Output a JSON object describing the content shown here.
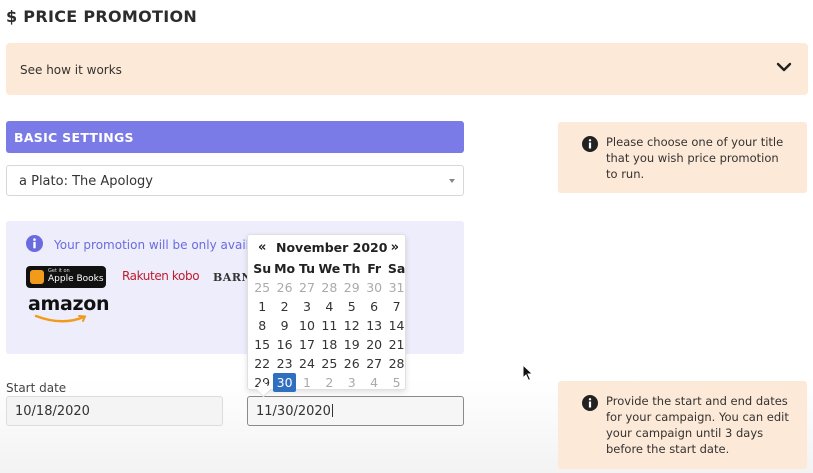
{
  "page": {
    "title": "$ PRICE PROMOTION"
  },
  "how_it_works": {
    "label": "See how it works",
    "icon": "chevron-down-icon"
  },
  "basic_settings": {
    "header": "BASIC SETTINGS",
    "title_select": {
      "value": "a Plato: The Apology"
    }
  },
  "info_title": {
    "text": "Please choose one of your title that you wish price promotion to run."
  },
  "availability": {
    "text": "Your promotion will be only availab",
    "stores": {
      "apple_small": "Get it on",
      "apple_big": "Apple Books",
      "kobo": "Rakuten kobo",
      "barnes": "BARNES",
      "amazon": "amazon"
    }
  },
  "dates": {
    "start_label": "Start date",
    "start_value": "10/18/2020",
    "end_value": "11/30/2020"
  },
  "info_dates": {
    "text": "Provide the start and end dates for your campaign. You can edit your campaign until 3 days before the start date."
  },
  "datepicker": {
    "prev": "«",
    "next": "»",
    "title": "November 2020",
    "days_of_week": [
      "Su",
      "Mo",
      "Tu",
      "We",
      "Th",
      "Fr",
      "Sa"
    ],
    "weeks": [
      [
        {
          "d": "25",
          "o": true
        },
        {
          "d": "26",
          "o": true
        },
        {
          "d": "27",
          "o": true
        },
        {
          "d": "28",
          "o": true
        },
        {
          "d": "29",
          "o": true
        },
        {
          "d": "30",
          "o": true
        },
        {
          "d": "31",
          "o": true
        }
      ],
      [
        {
          "d": "1"
        },
        {
          "d": "2"
        },
        {
          "d": "3"
        },
        {
          "d": "4"
        },
        {
          "d": "5"
        },
        {
          "d": "6"
        },
        {
          "d": "7"
        }
      ],
      [
        {
          "d": "8"
        },
        {
          "d": "9"
        },
        {
          "d": "10"
        },
        {
          "d": "11"
        },
        {
          "d": "12"
        },
        {
          "d": "13"
        },
        {
          "d": "14"
        }
      ],
      [
        {
          "d": "15"
        },
        {
          "d": "16"
        },
        {
          "d": "17"
        },
        {
          "d": "18"
        },
        {
          "d": "19"
        },
        {
          "d": "20"
        },
        {
          "d": "21"
        }
      ],
      [
        {
          "d": "22"
        },
        {
          "d": "23"
        },
        {
          "d": "24"
        },
        {
          "d": "25"
        },
        {
          "d": "26"
        },
        {
          "d": "27"
        },
        {
          "d": "28"
        }
      ],
      [
        {
          "d": "29"
        },
        {
          "d": "30",
          "a": true
        },
        {
          "d": "1",
          "o": true
        },
        {
          "d": "2",
          "o": true
        },
        {
          "d": "3",
          "o": true
        },
        {
          "d": "4",
          "o": true
        },
        {
          "d": "5",
          "o": true
        }
      ]
    ]
  },
  "colors": {
    "accent": "#7b7be8",
    "info_bg": "#fde9d7",
    "avail_bg": "#ededfb",
    "selected_day": "#2f6fc0"
  }
}
